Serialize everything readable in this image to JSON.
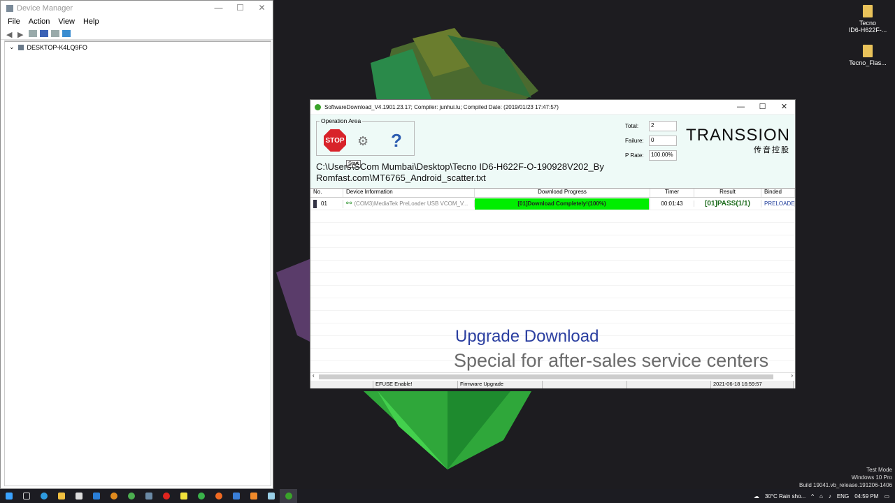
{
  "desktop": {
    "icons": [
      {
        "label_line1": "Tecno",
        "label_line2": "ID6-H622F-..."
      },
      {
        "label_line1": "Tecno_Flas...",
        "label_line2": ""
      }
    ],
    "watermark": {
      "line1": "Test Mode",
      "line2": "Windows 10 Pro",
      "line3": "Build 19041.vb_release.191206-1406"
    }
  },
  "device_manager": {
    "title": "Device Manager",
    "menu": [
      "File",
      "Action",
      "View",
      "Help"
    ],
    "tree_root": "DESKTOP-K4LQ9FO"
  },
  "sw": {
    "title": "SoftwareDownload_V4.1901.23.17; Compiler: junhui.lu; Compiled Date: (2019/01/23 17:47:57)",
    "operation_area": "Operation Area",
    "stop_label": "STOP",
    "tooltip": "Start",
    "help_glyph": "?",
    "stats": {
      "total_label": "Total:",
      "total": "2",
      "failure_label": "Failure:",
      "failure": "0",
      "prate_label": "P Rate:",
      "prate": "100.00%"
    },
    "logo_main": "TRANSSION",
    "logo_sub": "传音控股",
    "path_line1": "C:\\Users\\SCom Mumbai\\Desktop\\Tecno ID6-H622F-O-190928V202_By",
    "path_line2": "Romfast.com\\MT6765_Android_scatter.txt",
    "columns": [
      "No.",
      "Device Information",
      "Download Progress",
      "Timer",
      "Result",
      "Binded"
    ],
    "rows": [
      {
        "no": "01",
        "device": "(COM3)MediaTek PreLoader USB VCOM_V...",
        "progress_text": "[01]Download Completely!(100%)",
        "progress": 1.0,
        "timer": "00:01:43",
        "result": "[01]PASS(1/1)",
        "binded": "PRELOADER"
      }
    ],
    "watermark1": "Upgrade Download",
    "watermark2": "Special for after-sales service centers",
    "status": [
      "",
      "EFUSE Enable!",
      "Firmware Upgrade",
      "",
      "",
      "2021-06-18 16:59:57"
    ]
  },
  "taskbar": {
    "weather": "30°C  Rain sho...",
    "lang": "ENG",
    "time": "04:59 PM"
  }
}
